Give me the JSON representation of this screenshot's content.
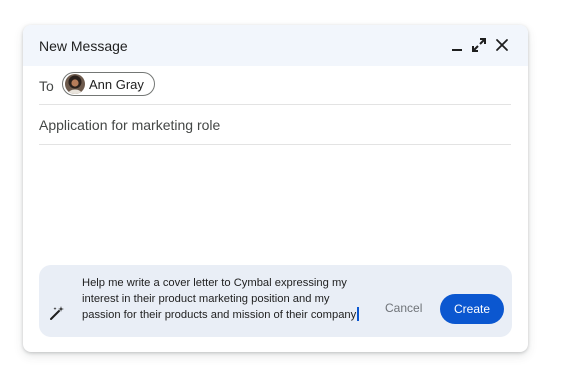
{
  "window": {
    "title": "New Message",
    "controls": {
      "minimize_icon": "minimize-icon",
      "expand_icon": "expand-icon",
      "close_icon": "close-icon"
    }
  },
  "recipients": {
    "label": "To",
    "chips": [
      {
        "name": "Ann Gray",
        "avatar_icon": "avatar-photo"
      }
    ]
  },
  "subject": {
    "value": "Application for marketing role"
  },
  "body": {
    "value": ""
  },
  "ai_prompt": {
    "icon": "magic-wand-icon",
    "lines": [
      "Help me write a cover letter to Cymbal expressing my",
      "interest in their product marketing position and my",
      "passion for their products and mission of their company"
    ],
    "cancel_label": "Cancel",
    "create_label": "Create"
  },
  "colors": {
    "header_bg": "#f2f6fc",
    "panel_bg": "#e9eef6",
    "primary": "#0b57d0",
    "divider": "#e3e3e3"
  }
}
